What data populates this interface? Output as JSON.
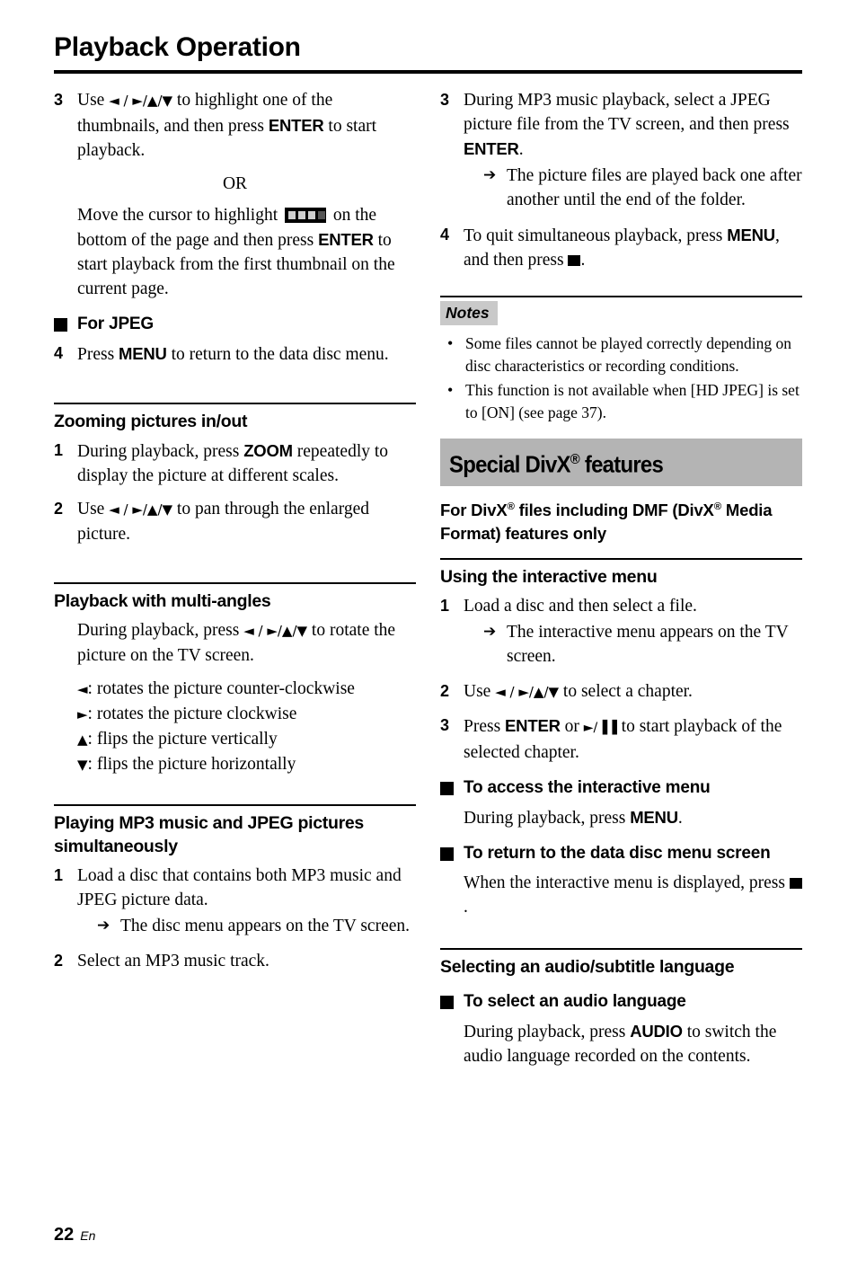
{
  "document": {
    "title": "Playback Operation",
    "footer": {
      "page_number": "22",
      "language_code": "En"
    }
  },
  "glyphs": {
    "arrow_set": "◄ / ►/▲/▼",
    "arrow_left": "◄",
    "arrow_right": "►",
    "arrow_up": "▲",
    "arrow_down": "▼",
    "result_arrow": "➔",
    "play_pause": "►/▐▐",
    "bullet_dot": "•"
  },
  "left_column": {
    "step3": {
      "number": "3",
      "text_before_arrows": "Use ",
      "text_after_arrows": " to highlight one of the thumbnails, and then press ",
      "key_enter": "ENTER",
      "text_end": " to start playback.",
      "or_label": "OR",
      "alt_before_icon": "Move the cursor to highlight ",
      "alt_icon_name": "filmstrip-icon",
      "alt_after_icon": " on the bottom of the page and then press ",
      "alt_key_enter": "ENTER",
      "alt_text_end": " to start playback from the first thumbnail on the current page."
    },
    "for_jpeg_heading": "For JPEG",
    "step4": {
      "number": "4",
      "text_before": "Press ",
      "key_menu": "MENU",
      "text_after": " to return to the data disc menu."
    },
    "zooming_section": {
      "heading": "Zooming pictures in/out",
      "step1": {
        "number": "1",
        "text_before": "During playback, press ",
        "key_zoom": "ZOOM",
        "text_after": " repeatedly to display the picture at different scales."
      },
      "step2": {
        "number": "2",
        "text_before": "Use ",
        "text_after": " to pan through the enlarged picture."
      }
    },
    "multi_angles_section": {
      "heading": "Playback with multi-angles",
      "intro_before": "During playback, press ",
      "intro_after": " to rotate the picture on the TV screen.",
      "legend": [
        {
          "key": "◄",
          "desc": ": rotates the picture counter-clockwise"
        },
        {
          "key": "►",
          "desc": ": rotates the picture clockwise"
        },
        {
          "key": "▲",
          "desc": ": flips the picture vertically"
        },
        {
          "key": "▼",
          "desc": ": flips the picture horizontally"
        }
      ]
    },
    "mp3_jpeg_section": {
      "heading": "Playing MP3 music and JPEG pictures simultaneously",
      "step1": {
        "number": "1",
        "text": "Load a disc that contains both MP3 music and JPEG picture data.",
        "result": "The disc menu appears on the TV screen."
      },
      "step2": {
        "number": "2",
        "text": "Select an MP3 music track."
      }
    }
  },
  "right_column": {
    "step3": {
      "number": "3",
      "text_before": "During MP3 music playback, select a JPEG picture file from the TV screen, and then press ",
      "key_enter": "ENTER",
      "text_after": ".",
      "result": "The picture files are played back one after another until the end of the folder."
    },
    "step4": {
      "number": "4",
      "text_before": "To quit simultaneous playback, press ",
      "key_menu": "MENU",
      "text_mid": ", and then press ",
      "stop_icon_name": "stop-button-icon",
      "text_after": "."
    },
    "notes": {
      "label": "Notes",
      "items": [
        "Some files cannot be played correctly depending on disc characteristics or recording conditions.",
        "This function is not available when [HD JPEG] is set to [ON] (see page 37)."
      ]
    },
    "divx_section": {
      "banner_title_pre": "Special DivX",
      "banner_title_sup": "®",
      "banner_title_post": " features",
      "subtitle_pre": "For DivX",
      "subtitle_sup1": "®",
      "subtitle_mid": " files including DMF (DivX",
      "subtitle_sup2": "®",
      "subtitle_post": " Media Format) features only",
      "interactive_menu": {
        "heading": "Using the interactive menu",
        "step1": {
          "number": "1",
          "text": "Load a disc and then select a file.",
          "result": "The interactive menu appears on the TV screen."
        },
        "step2": {
          "number": "2",
          "text_before": "Use ",
          "text_after": " to select a chapter."
        },
        "step3": {
          "number": "3",
          "text_before": "Press ",
          "key_enter": "ENTER",
          "text_mid": " or ",
          "text_after": " to start playback of the selected chapter."
        }
      },
      "access_menu": {
        "heading": "To access the interactive menu",
        "body_before": "During playback, press ",
        "key_menu": "MENU",
        "body_after": "."
      },
      "return_menu": {
        "heading": "To return to the data disc menu screen",
        "body_before": "When the interactive menu is displayed, press ",
        "stop_icon_name": "stop-button-icon",
        "body_after": "."
      }
    },
    "audio_subtitle_section": {
      "heading": "Selecting an audio/subtitle language",
      "select_audio": {
        "heading": "To select an audio language",
        "body_before": "During playback, press ",
        "key_audio": "AUDIO",
        "body_after": " to switch the audio language recorded on the contents."
      }
    }
  },
  "colors": {
    "banner_gray": "#b4b4b4",
    "notes_gray": "#c9c9c9",
    "text_black": "#000000",
    "page_white": "#ffffff"
  }
}
